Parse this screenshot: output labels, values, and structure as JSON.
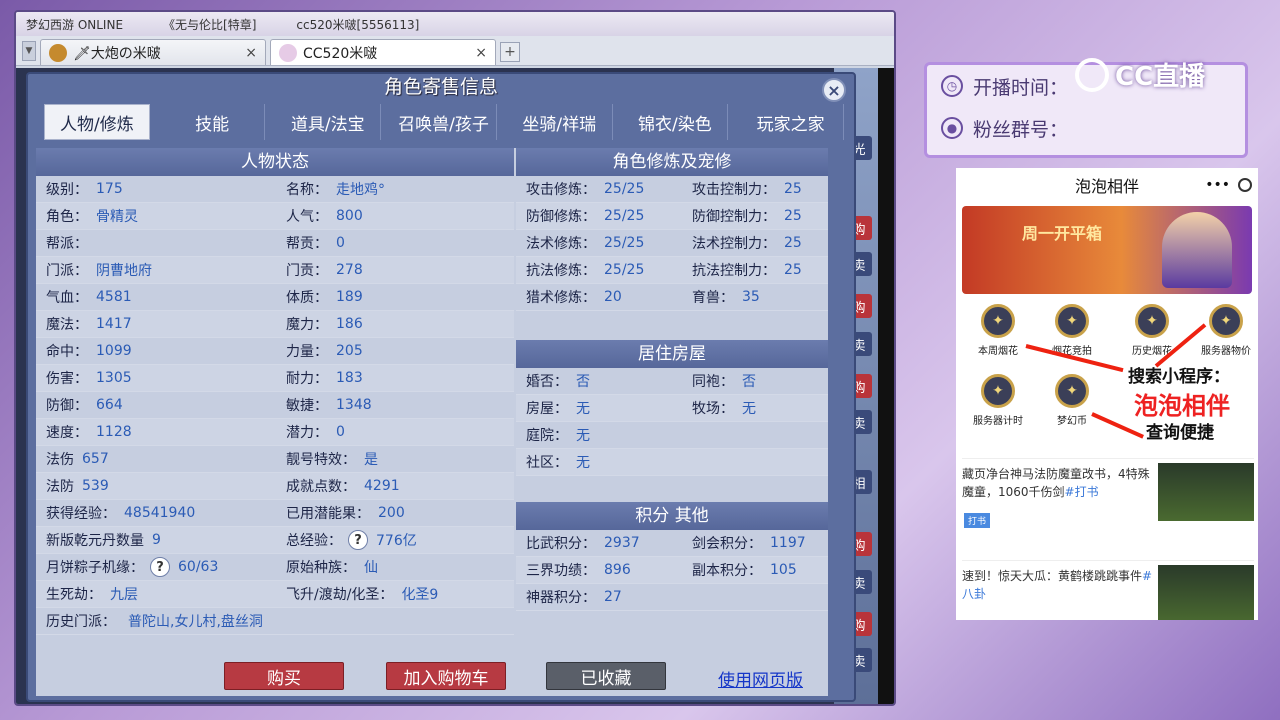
{
  "window": {
    "title_parts": [
      "梦幻西游 ONLINE",
      "《无与伦比[特章]",
      "cc520米啵[5556113]"
    ]
  },
  "browser_tabs": [
    {
      "label": "🗡大炮の米啵",
      "close": "×"
    },
    {
      "label": "CC520米啵",
      "close": "×"
    }
  ],
  "new_tab": "+",
  "dialog": {
    "title": "角色寄售信息",
    "close": "×",
    "tabs": [
      "人物/修炼",
      "技能",
      "道具/法宝",
      "召唤兽/孩子",
      "坐骑/祥瑞",
      "锦衣/染色",
      "玩家之家"
    ],
    "status": {
      "heading": "人物状态",
      "rows": [
        [
          [
            "级别：",
            "175"
          ],
          [
            "名称：",
            "走地鸡°"
          ]
        ],
        [
          [
            "角色：",
            "骨精灵"
          ],
          [
            "人气：",
            "800"
          ]
        ],
        [
          [
            "帮派：",
            ""
          ],
          [
            "帮贡：",
            "0"
          ]
        ],
        [
          [
            "门派：",
            "阴曹地府"
          ],
          [
            "门贡：",
            "278"
          ]
        ],
        [
          [
            "气血：",
            "4581"
          ],
          [
            "体质：",
            "189"
          ]
        ],
        [
          [
            "魔法：",
            "1417"
          ],
          [
            "魔力：",
            "186"
          ]
        ],
        [
          [
            "命中：",
            "1099"
          ],
          [
            "力量：",
            "205"
          ]
        ],
        [
          [
            "伤害：",
            "1305"
          ],
          [
            "耐力：",
            "183"
          ]
        ],
        [
          [
            "防御：",
            "664"
          ],
          [
            "敏捷：",
            "1348"
          ]
        ],
        [
          [
            "速度：",
            "1128"
          ],
          [
            "潜力：",
            "0"
          ]
        ],
        [
          [
            "法伤",
            "657"
          ],
          [
            "靓号特效：",
            "是"
          ]
        ],
        [
          [
            "法防",
            "539"
          ],
          [
            "成就点数：",
            "4291"
          ]
        ],
        [
          [
            "获得经验：",
            "48541940"
          ],
          [
            "已用潜能果：",
            "200"
          ]
        ],
        [
          [
            "新版乾元丹数量",
            "9"
          ],
          [
            "总经验：",
            "776亿"
          ]
        ],
        [
          [
            "月饼粽子机缘：",
            "60/63"
          ],
          [
            "原始种族：",
            "仙"
          ]
        ],
        [
          [
            "生死劫：",
            "九层"
          ],
          [
            "飞升/渡劫/化圣：",
            "化圣9"
          ]
        ]
      ],
      "history_label": "历史门派：",
      "history_value": "普陀山,女儿村,盘丝洞",
      "help": "?"
    },
    "cultivation": {
      "heading": "角色修炼及宠修",
      "rows": [
        [
          [
            "攻击修炼：",
            "25/25"
          ],
          [
            "攻击控制力：",
            "25"
          ]
        ],
        [
          [
            "防御修炼：",
            "25/25"
          ],
          [
            "防御控制力：",
            "25"
          ]
        ],
        [
          [
            "法术修炼：",
            "25/25"
          ],
          [
            "法术控制力：",
            "25"
          ]
        ],
        [
          [
            "抗法修炼：",
            "25/25"
          ],
          [
            "抗法控制力：",
            "25"
          ]
        ],
        [
          [
            "猎术修炼：",
            "20"
          ],
          [
            "育兽：",
            "35"
          ]
        ]
      ]
    },
    "housing": {
      "heading": "居住房屋",
      "rows": [
        [
          [
            "婚否：",
            "否"
          ],
          [
            "同袍：",
            "否"
          ]
        ],
        [
          [
            "房屋：",
            "无"
          ],
          [
            "牧场：",
            "无"
          ]
        ],
        [
          [
            "庭院：",
            "无"
          ],
          [
            "",
            ""
          ]
        ],
        [
          [
            "社区：",
            "无"
          ],
          [
            "",
            ""
          ]
        ]
      ]
    },
    "points": {
      "heading": "积分 其他",
      "rows": [
        [
          [
            "比武积分：",
            "2937"
          ],
          [
            "剑会积分：",
            "1197"
          ]
        ],
        [
          [
            "三界功绩：",
            "896"
          ],
          [
            "副本积分：",
            "105"
          ]
        ],
        [
          [
            "神器积分：",
            "27"
          ],
          [
            "",
            ""
          ]
        ]
      ]
    },
    "buttons": {
      "buy": "购买",
      "cart": "加入购物车",
      "fav": "已收藏",
      "web": "使用网页版"
    }
  },
  "side_buttons": [
    "光",
    "购",
    "卖",
    "购",
    "卖",
    "购",
    "卖",
    "相",
    "购",
    "卖",
    "购",
    "卖"
  ],
  "overlay": {
    "logo": "CC直播",
    "start_time_label": "开播时间：",
    "fan_group_label": "粉丝群号："
  },
  "phone": {
    "title": "泡泡相伴",
    "dots": "•••",
    "banner_text": "周一开平箱",
    "grid": [
      "本周烟花",
      "烟花竞拍",
      "历史烟花",
      "服务器物价",
      "服务器计时",
      "梦幻币"
    ],
    "promo_line1": "搜索小程序：",
    "promo_line2": "泡泡相伴",
    "promo_line3": "查询便捷",
    "news": [
      {
        "text": "藏页净台神马法防魔童改书，4特殊魔童，1060千伤剑",
        "tag": "#打书",
        "chip": "打书"
      },
      {
        "text": "速到！惊天大瓜：黄鹤楼跳跳事件",
        "tag": "#八卦",
        "chip": ""
      }
    ]
  },
  "colors": {
    "accent": "#5c6e9f",
    "buy_red": "#b73a42",
    "link": "#1536c8",
    "value_blue": "#2b5bb5"
  }
}
